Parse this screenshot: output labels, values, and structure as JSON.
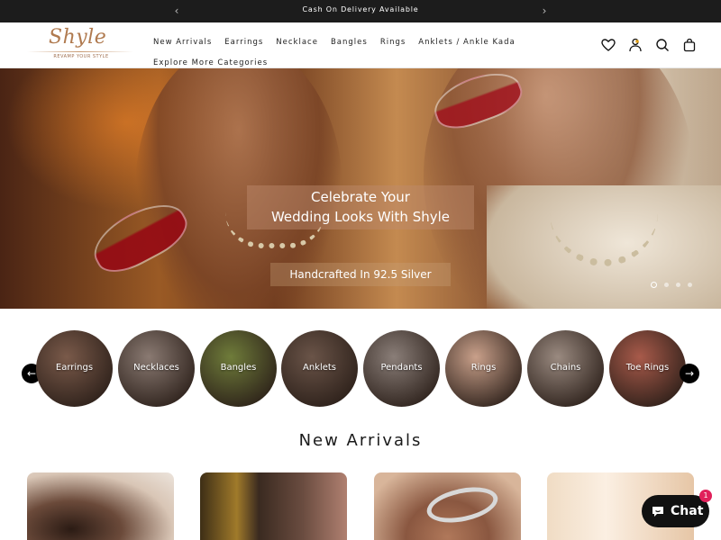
{
  "announcement": {
    "text": "Cash On Delivery Available",
    "prev_icon": "chevron-left-icon",
    "next_icon": "chevron-right-icon"
  },
  "header": {
    "logo": {
      "wordmark": "Shyle",
      "tagline": "REVAMP YOUR STYLE"
    },
    "nav": [
      {
        "label": "New Arrivals"
      },
      {
        "label": "Earrings"
      },
      {
        "label": "Necklace"
      },
      {
        "label": "Bangles"
      },
      {
        "label": "Rings"
      },
      {
        "label": "Anklets / Ankle Kada"
      },
      {
        "label": "Explore More Categories"
      }
    ],
    "icons": [
      "heart-icon",
      "account-icon",
      "search-icon",
      "bag-icon"
    ]
  },
  "hero": {
    "headline_line1": "Celebrate Your",
    "headline_line2": "Wedding Looks With Shyle",
    "subline": "Handcrafted In 92.5 Silver",
    "slides": 4,
    "active_slide": 1
  },
  "categories": {
    "items": [
      {
        "label": "Earrings",
        "color": "#7a5a4a"
      },
      {
        "label": "Necklaces",
        "color": "#8a7a72"
      },
      {
        "label": "Bangles",
        "color": "#6f7c3a"
      },
      {
        "label": "Anklets",
        "color": "#6a5448"
      },
      {
        "label": "Pendants",
        "color": "#8a7e78"
      },
      {
        "label": "Rings",
        "color": "#c9a08a"
      },
      {
        "label": "Chains",
        "color": "#9a8a80"
      },
      {
        "label": "Toe Rings",
        "color": "#a85a4a"
      }
    ],
    "prev_icon": "arrow-left-icon",
    "next_icon": "arrow-right-icon"
  },
  "new_arrivals": {
    "title": "New Arrivals"
  },
  "chat": {
    "label": "Chat",
    "badge": "1",
    "icon": "chat-bubble-icon"
  }
}
